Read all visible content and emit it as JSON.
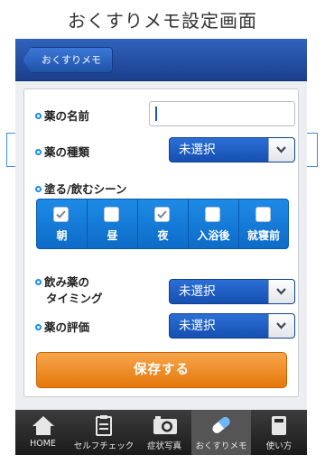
{
  "page_title": "おくすりメモ設定画面",
  "header": {
    "back_label": "おくすりメモ"
  },
  "form": {
    "name_label": "薬の名前",
    "name_value": "",
    "type_label": "薬の種類",
    "type_value": "未選択",
    "scene_label": "塗る/飲むシーン",
    "scenes": [
      {
        "label": "朝",
        "checked": true
      },
      {
        "label": "昼",
        "checked": false
      },
      {
        "label": "夜",
        "checked": true
      },
      {
        "label": "入浴後",
        "checked": false
      },
      {
        "label": "就寝前",
        "checked": false
      }
    ],
    "timing_label_line1": "飲み薬の",
    "timing_label_line2": "タイミング",
    "timing_value": "未選択",
    "rating_label": "薬の評価",
    "rating_value": "未選択",
    "save_label": "保存する"
  },
  "tabs": [
    {
      "label": "HOME",
      "icon": "home-icon",
      "active": false
    },
    {
      "label": "セルフチェック",
      "icon": "clipboard-icon",
      "active": false
    },
    {
      "label": "症状写真",
      "icon": "camera-icon",
      "active": false
    },
    {
      "label": "おくすりメモ",
      "icon": "pill-icon",
      "active": true
    },
    {
      "label": "使い方",
      "icon": "book-icon",
      "active": false
    }
  ],
  "colors": {
    "header_blue": "#2f63bd",
    "select_blue": "#1a60c6",
    "accent_orange": "#f08c1e",
    "tabbar_dark": "#222222"
  }
}
